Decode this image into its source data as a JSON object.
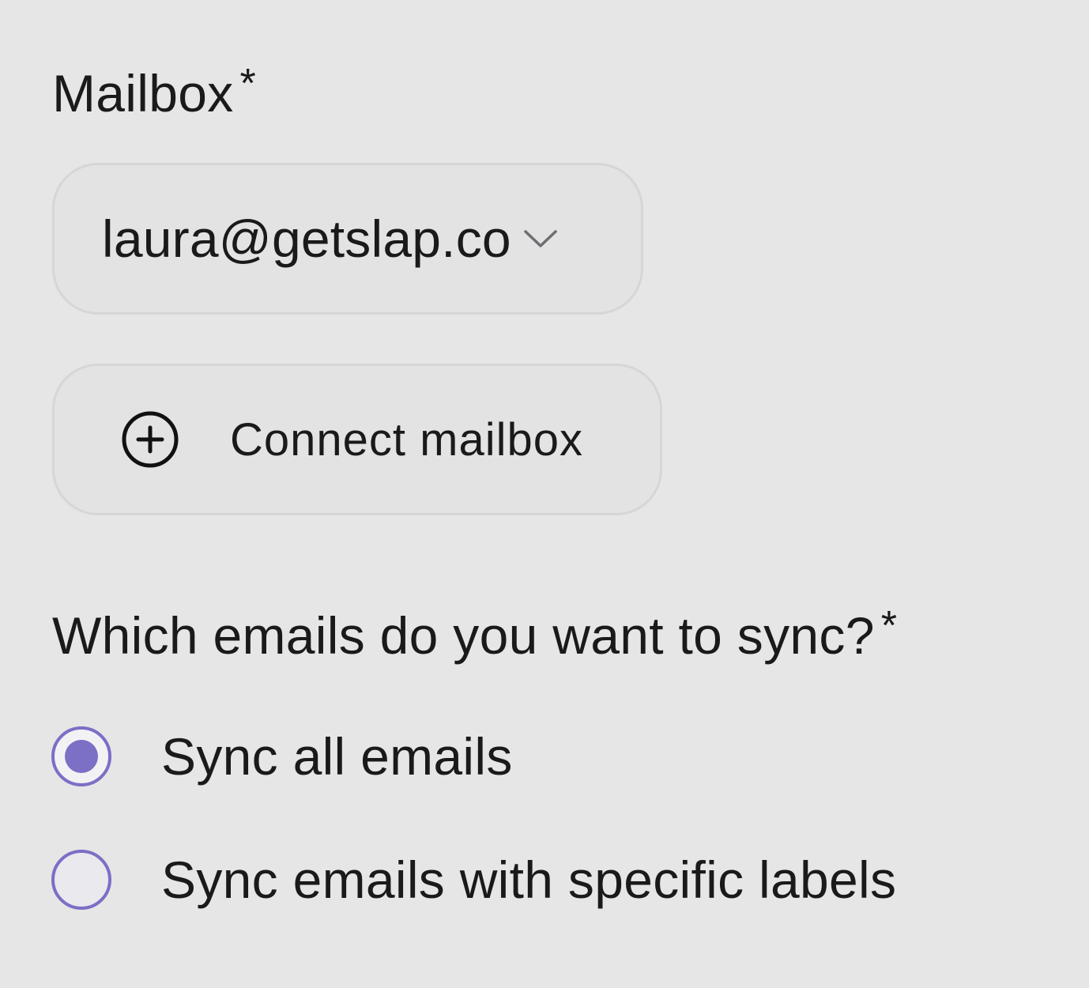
{
  "mailbox": {
    "label": "Mailbox",
    "required_mark": "*",
    "selected": "laura@getslap.co",
    "chevron_icon": "chevron-down-icon",
    "connect_label": "Connect mailbox",
    "connect_icon": "plus-circle-icon"
  },
  "sync": {
    "label": "Which emails do you want to sync?",
    "required_mark": "*",
    "options": [
      {
        "label": "Sync all emails",
        "selected": true
      },
      {
        "label": "Sync emails with specific labels",
        "selected": false
      }
    ]
  },
  "colors": {
    "background": "#e6e6e6",
    "radio_accent": "#7b6fc6",
    "text": "#1a1a1a"
  }
}
